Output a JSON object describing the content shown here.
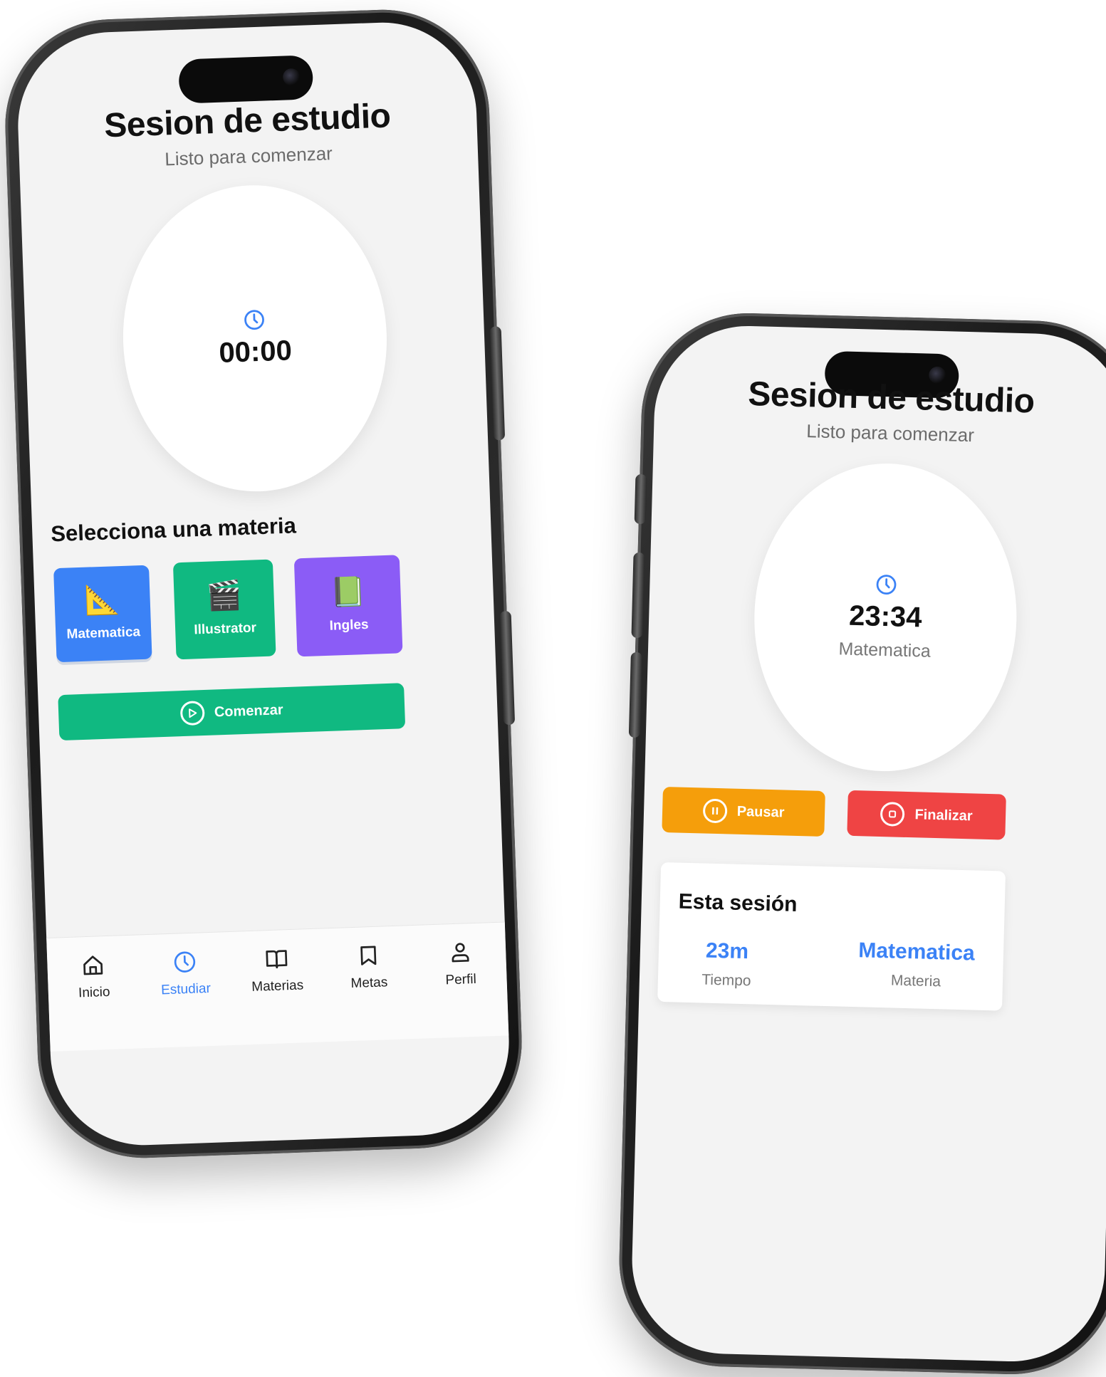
{
  "left_phone": {
    "title": "Sesion de estudio",
    "subtitle": "Listo para comenzar",
    "timer": {
      "icon": "clock-icon",
      "time": "00:00"
    },
    "section_heading": "Selecciona una materia",
    "subjects": [
      {
        "label": "Matematica",
        "icon": "triangle-ruler-icon",
        "color": "#3b82f6",
        "glyph": "📐"
      },
      {
        "label": "Illustrator",
        "icon": "clapperboard-icon",
        "color": "#10b981",
        "glyph": "🎬"
      },
      {
        "label": "Ingles",
        "icon": "book-icon",
        "color": "#8b5cf6",
        "glyph": "📗"
      }
    ],
    "start_button": {
      "label": "Comenzar",
      "icon": "play-circle-icon",
      "color": "#10b981"
    },
    "nav": [
      {
        "label": "Inicio",
        "icon": "home-icon",
        "active": false
      },
      {
        "label": "Estudiar",
        "icon": "clock-icon",
        "active": true
      },
      {
        "label": "Materias",
        "icon": "open-book-icon",
        "active": false
      },
      {
        "label": "Metas",
        "icon": "bookmark-icon",
        "active": false
      },
      {
        "label": "Perfil",
        "icon": "user-icon",
        "active": false
      }
    ]
  },
  "right_phone": {
    "title": "Sesion de estudio",
    "subtitle": "Listo para comenzar",
    "timer": {
      "icon": "clock-icon",
      "time": "23:34",
      "subject": "Matematica"
    },
    "pause_button": {
      "label": "Pausar",
      "icon": "pause-circle-icon",
      "color": "#f59e0b"
    },
    "finish_button": {
      "label": "Finalizar",
      "icon": "stop-circle-icon",
      "color": "#ef4444"
    },
    "session_card": {
      "title": "Esta sesión",
      "stats": [
        {
          "value": "23m",
          "label": "Tiempo"
        },
        {
          "value": "Matematica",
          "label": "Materia"
        }
      ]
    }
  },
  "colors": {
    "accent": "#3b82f6",
    "background": "#f3f3f3"
  }
}
